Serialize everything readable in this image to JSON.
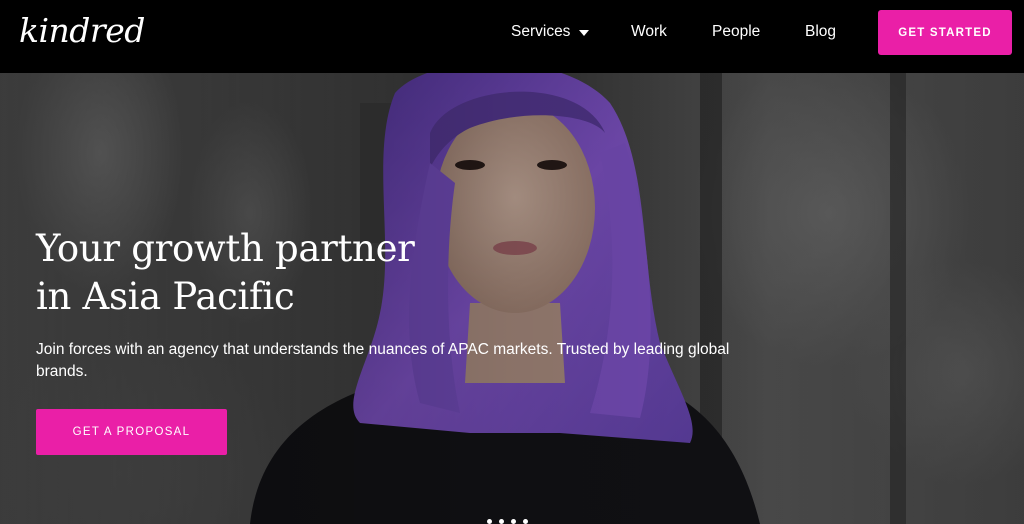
{
  "brand": {
    "logo_text": "kindred"
  },
  "nav": {
    "services_label": "Services",
    "work_label": "Work",
    "people_label": "People",
    "blog_label": "Blog",
    "cta_label": "GET STARTED"
  },
  "hero": {
    "heading_line1": "Your growth partner",
    "heading_line2": "in Asia Pacific",
    "subtitle": "Join forces with an agency that understands the nuances of APAC markets. Trusted by leading global brands.",
    "cta_label": "GET A PROPOSAL",
    "carousel_dot_count": 4
  },
  "colors": {
    "accent": "#ea1fa7",
    "nav_background": "#000000",
    "hair": "#7b4fc9"
  }
}
